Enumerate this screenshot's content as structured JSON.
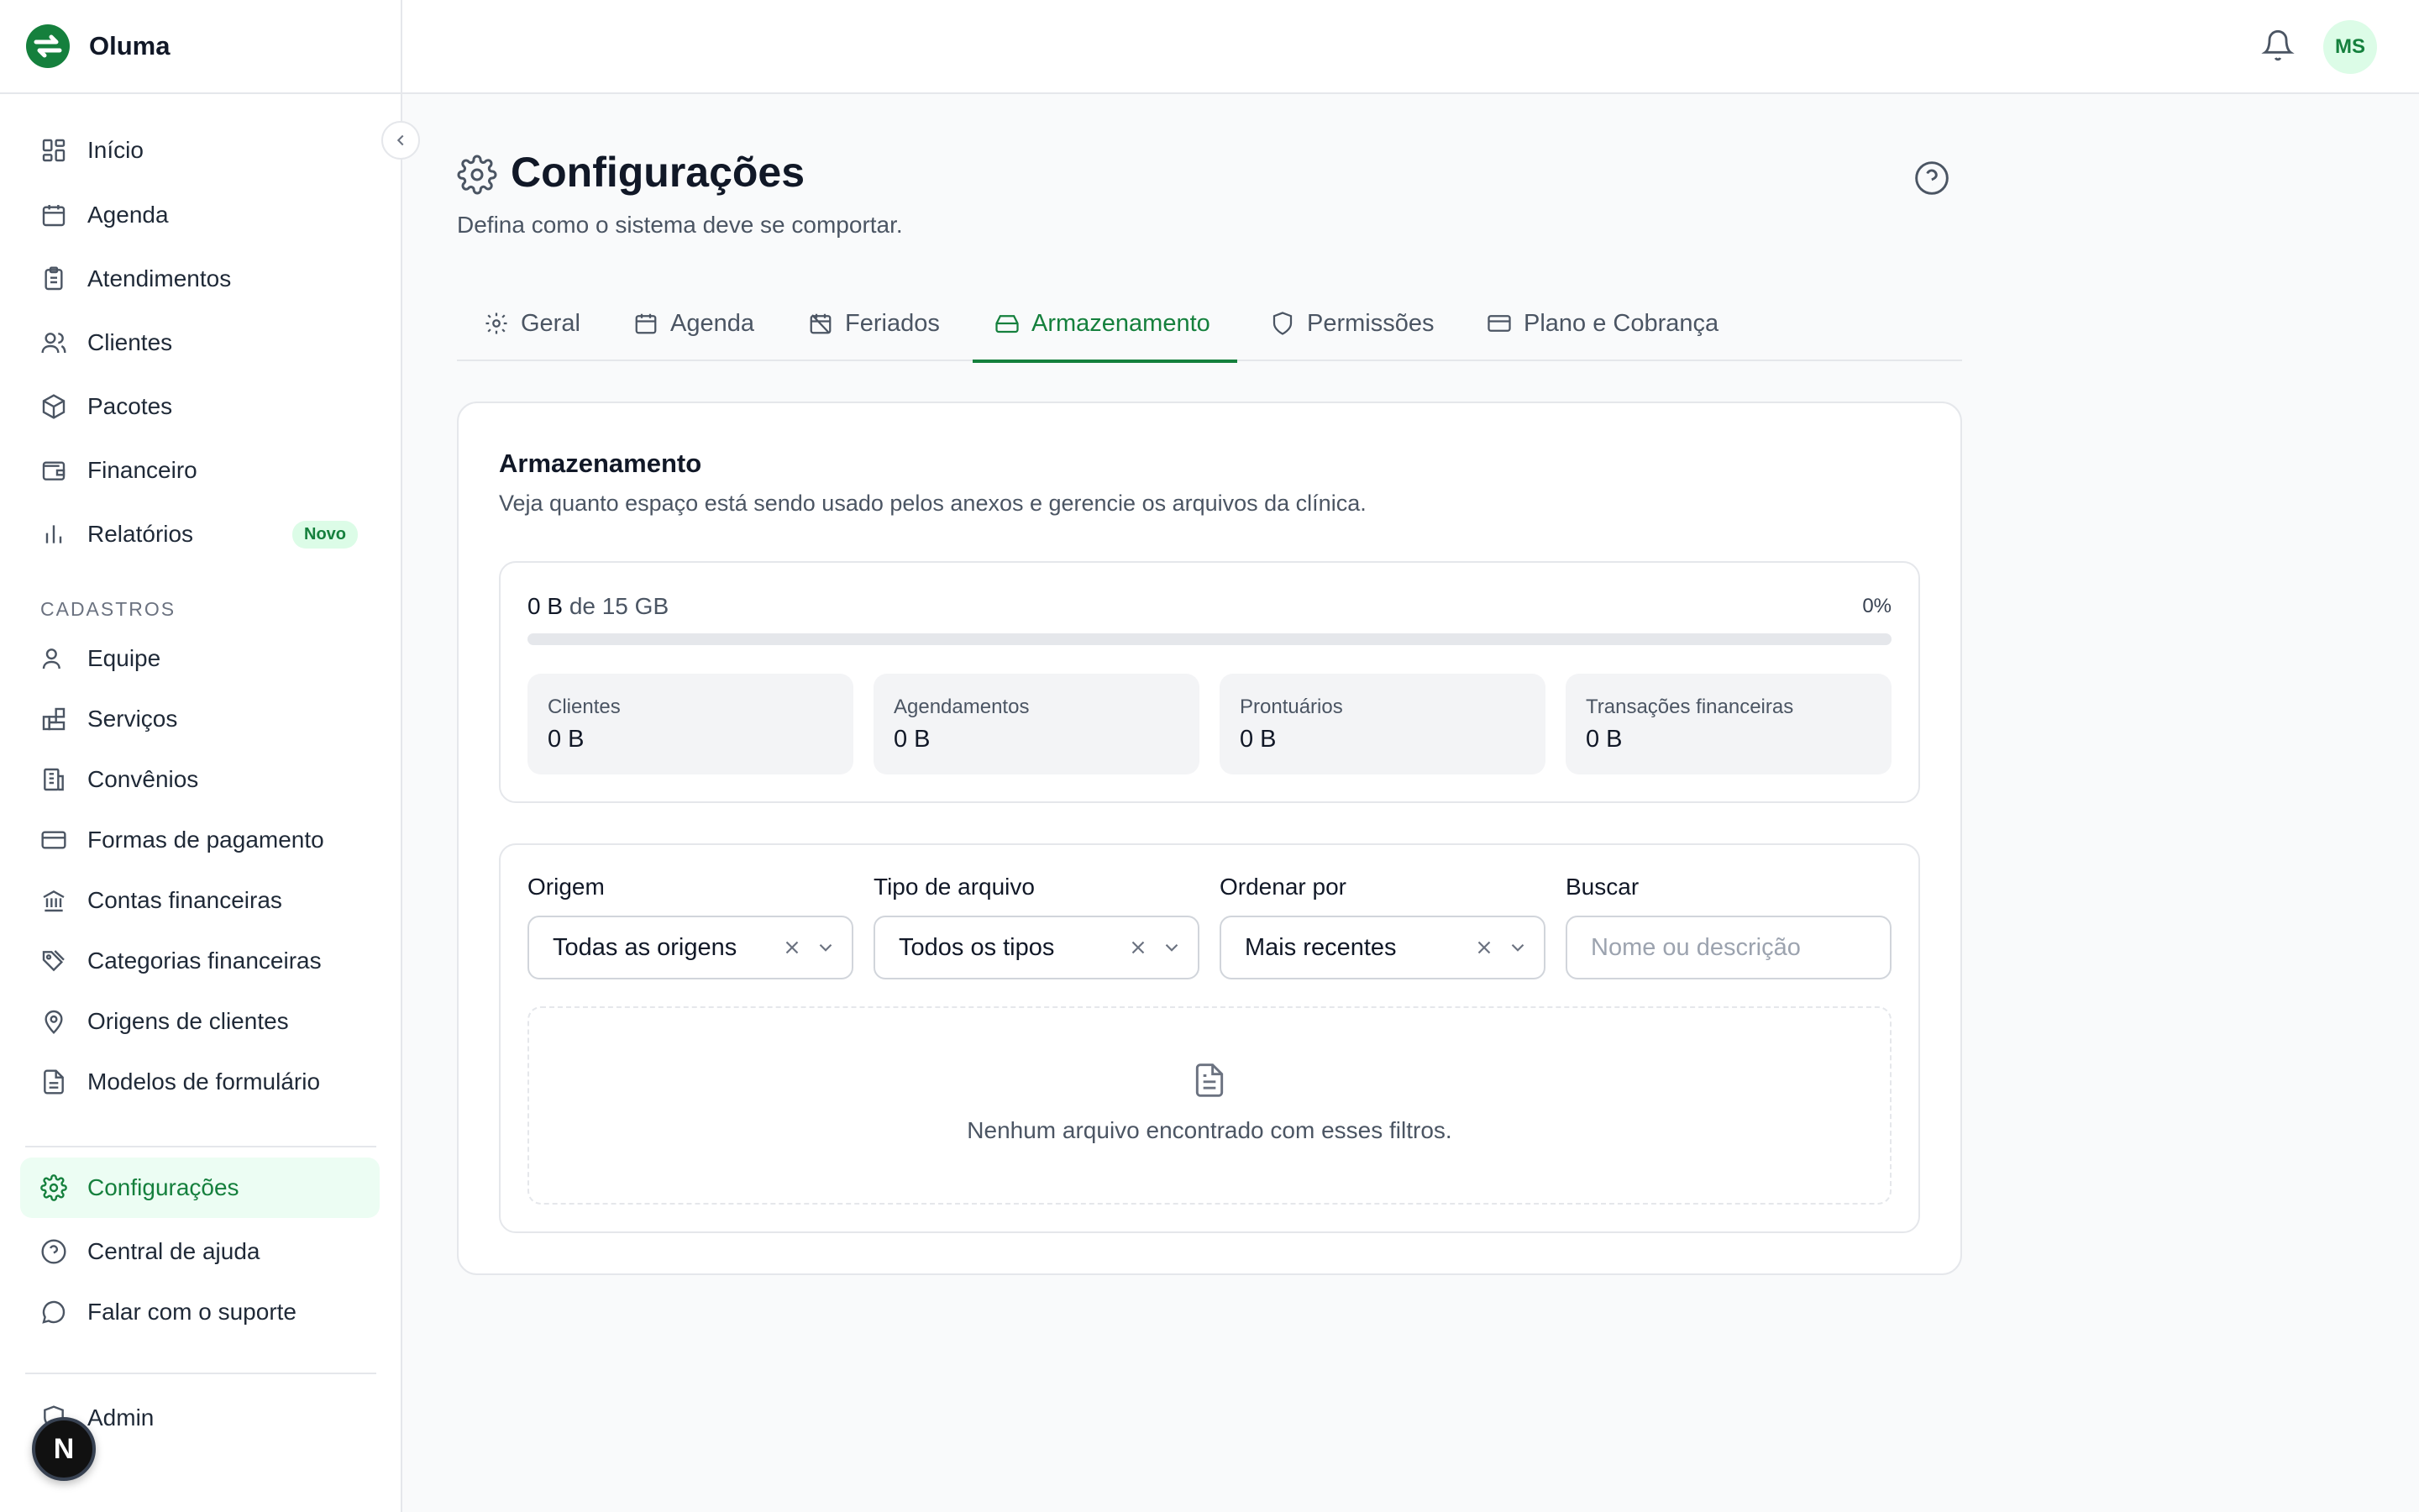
{
  "app": {
    "name": "Oluma"
  },
  "sidebar": {
    "items": [
      {
        "label": "Início"
      },
      {
        "label": "Agenda"
      },
      {
        "label": "Atendimentos"
      },
      {
        "label": "Clientes"
      },
      {
        "label": "Pacotes"
      },
      {
        "label": "Financeiro"
      },
      {
        "label": "Relatórios",
        "badge": "Novo"
      }
    ],
    "section_label": "CADASTROS",
    "cadastros": [
      {
        "label": "Equipe"
      },
      {
        "label": "Serviços"
      },
      {
        "label": "Convênios"
      },
      {
        "label": "Formas de pagamento"
      },
      {
        "label": "Contas financeiras"
      },
      {
        "label": "Categorias financeiras"
      },
      {
        "label": "Origens de clientes"
      },
      {
        "label": "Modelos de formulário"
      }
    ],
    "bottom": [
      {
        "label": "Configurações",
        "active": true
      },
      {
        "label": "Central de ajuda"
      },
      {
        "label": "Falar com o suporte"
      }
    ],
    "admin": {
      "label": "Admin"
    },
    "dev_badge": "N"
  },
  "topbar": {
    "avatar_initials": "MS"
  },
  "page": {
    "title": "Configurações",
    "subtitle": "Defina como o sistema deve se comportar."
  },
  "tabs": [
    {
      "label": "Geral"
    },
    {
      "label": "Agenda"
    },
    {
      "label": "Feriados"
    },
    {
      "label": "Armazenamento",
      "active": true
    },
    {
      "label": "Permissões"
    },
    {
      "label": "Plano e Cobrança"
    }
  ],
  "storage": {
    "title": "Armazenamento",
    "subtitle": "Veja quanto espaço está sendo usado pelos anexos e gerencie os arquivos da clínica.",
    "used": "0 B",
    "of_text": "de 15 GB",
    "percent_label": "0%",
    "usage_fraction": 0,
    "breakdown": [
      {
        "label": "Clientes",
        "value": "0 B"
      },
      {
        "label": "Agendamentos",
        "value": "0 B"
      },
      {
        "label": "Prontuários",
        "value": "0 B"
      },
      {
        "label": "Transações financeiras",
        "value": "0 B"
      }
    ]
  },
  "filters": {
    "origem": {
      "label": "Origem",
      "value": "Todas as origens"
    },
    "tipo": {
      "label": "Tipo de arquivo",
      "value": "Todos os tipos"
    },
    "ordenar": {
      "label": "Ordenar por",
      "value": "Mais recentes"
    },
    "buscar": {
      "label": "Buscar",
      "placeholder": "Nome ou descrição"
    }
  },
  "empty_state": {
    "message": "Nenhum arquivo encontrado com esses filtros."
  },
  "colors": {
    "accent": "#15803d",
    "accent_bg": "#ecfdf3",
    "border": "#e5e7eb"
  }
}
